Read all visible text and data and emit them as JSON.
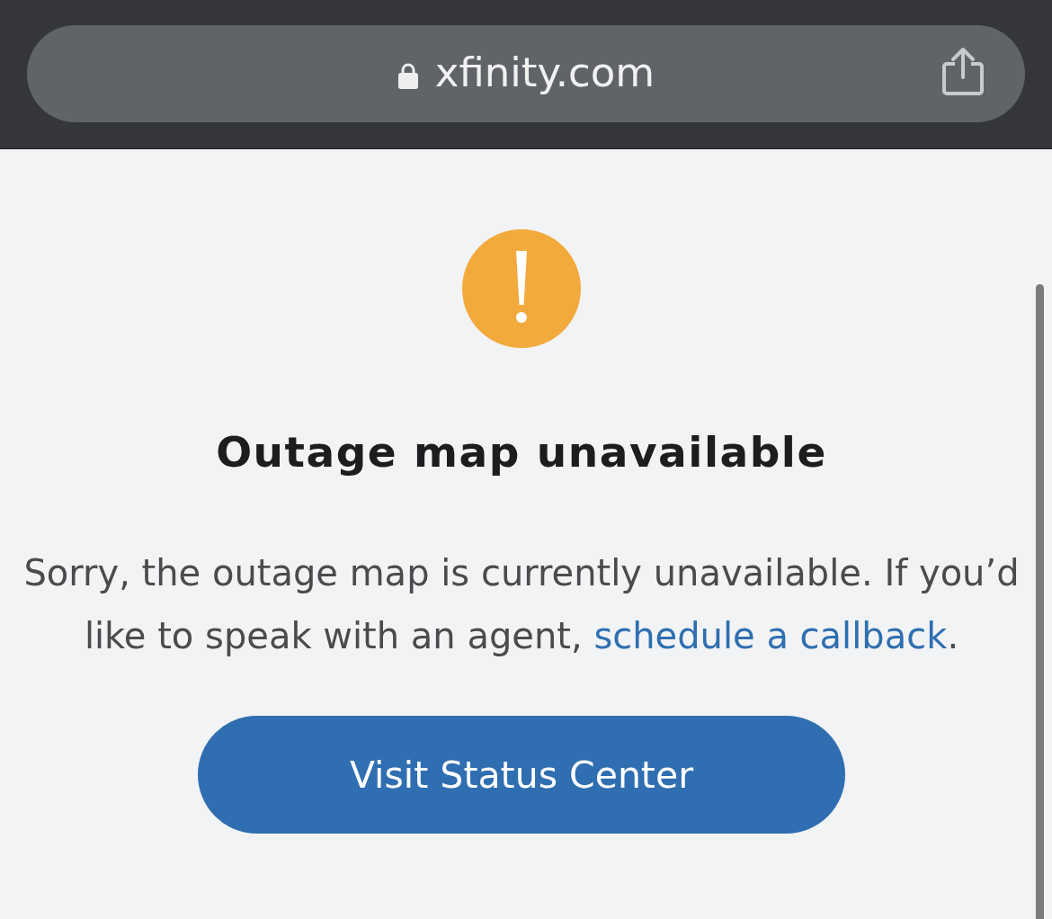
{
  "browser_bar": {
    "secure": true,
    "url": "xfinity.com"
  },
  "alert": {
    "kind": "warning",
    "title": "Outage map unavailable",
    "message": [
      {
        "kind": "text",
        "text": "Sorry, the outage map is currently unavailable. If you’d like to speak with an agent, "
      },
      {
        "kind": "link",
        "text": "schedule a callback"
      },
      {
        "kind": "text",
        "text": "."
      }
    ]
  },
  "button": {
    "label": "Visit Status Center"
  }
}
